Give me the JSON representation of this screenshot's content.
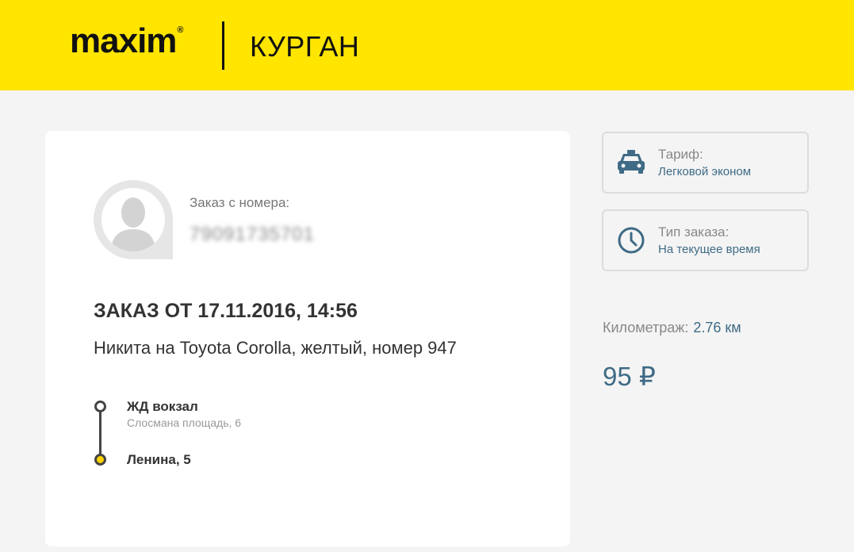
{
  "header": {
    "brand": "maxim",
    "brand_mark": "®",
    "city": "КУРГАН",
    "background_color": "#ffe500"
  },
  "order": {
    "phone_label": "Заказ с номера:",
    "phone_value": "79091735701",
    "title": "ЗАКАЗ ОТ 17.11.2016, 14:56",
    "driver": "Никита на Toyota Corolla, желтый, номер 947",
    "route": [
      {
        "title": "ЖД вокзал",
        "address": "Слосмана площадь, 6"
      },
      {
        "title": "Ленина, 5",
        "address": ""
      }
    ]
  },
  "sidebar": {
    "tariff": {
      "icon": "taxi-icon",
      "label": "Тариф:",
      "value": "Легковой эконом"
    },
    "order_type": {
      "icon": "clock-icon",
      "label": "Тип заказа:",
      "value": "На текущее время"
    },
    "distance_label": "Километраж:",
    "distance_value": "2.76 км",
    "price": "95 ₽",
    "accent_color": "#3f6b86"
  }
}
